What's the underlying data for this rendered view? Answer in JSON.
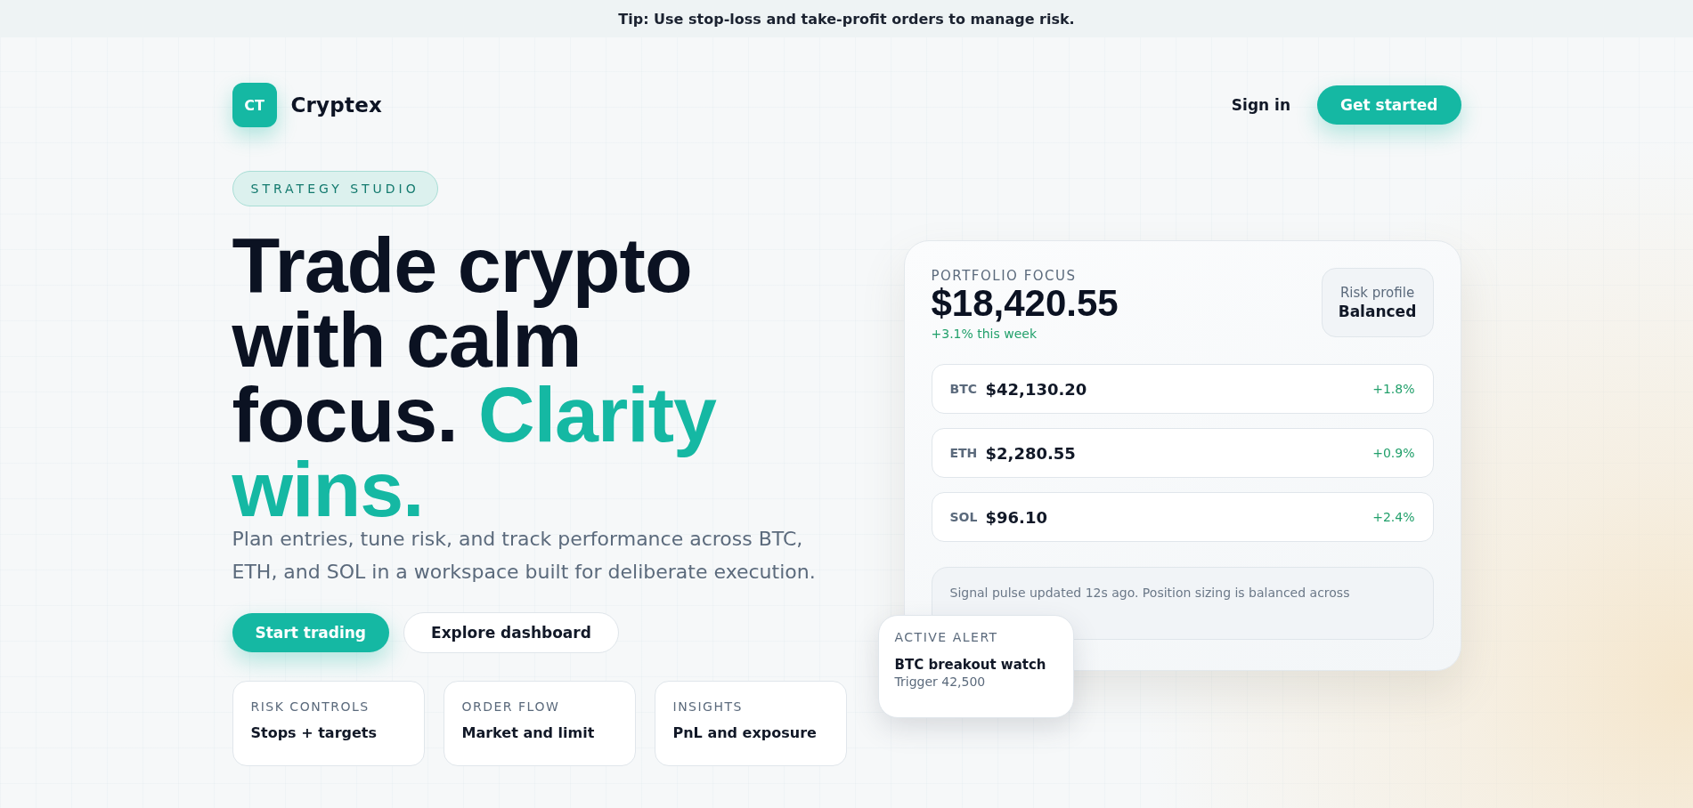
{
  "tip": "Tip: Use stop-loss and take-profit orders to manage risk.",
  "brand": {
    "mark": "CT",
    "name": "Cryptex"
  },
  "nav": {
    "sign_in": "Sign in",
    "cta": "Get started"
  },
  "hero": {
    "badge": "STRATEGY STUDIO",
    "headline": [
      [
        {
          "text": "Trade crypto",
          "accent": false
        }
      ],
      [
        {
          "text": "with calm",
          "accent": false
        }
      ],
      [
        {
          "text": "focus.",
          "accent": false
        },
        {
          "text": "Clarity",
          "accent": true
        }
      ],
      [
        {
          "text": "wins.",
          "accent": true
        }
      ]
    ],
    "lead": "Plan entries, tune risk, and track performance across BTC, ETH, and SOL in a workspace built for deliberate execution.",
    "buttons": [
      {
        "label": "Start trading",
        "kind": "primary"
      },
      {
        "label": "Explore dashboard",
        "kind": "secondary"
      }
    ],
    "features": [
      {
        "label": "RISK CONTROLS",
        "value": "Stops + targets"
      },
      {
        "label": "ORDER FLOW",
        "value": "Market and limit"
      },
      {
        "label": "INSIGHTS",
        "value": "PnL and exposure"
      }
    ]
  },
  "portfolio": {
    "label": "PORTFOLIO FOCUS",
    "value": "$18,420.55",
    "change": "+3.1% this week",
    "risk": {
      "label": "Risk profile",
      "value": "Balanced"
    },
    "assets": [
      {
        "symbol": "BTC",
        "price": "$42,130.20",
        "change": "+1.8%"
      },
      {
        "symbol": "ETH",
        "price": "$2,280.55",
        "change": "+0.9%"
      },
      {
        "symbol": "SOL",
        "price": "$96.10",
        "change": "+2.4%"
      }
    ],
    "note": "Signal pulse updated 12s ago. Position sizing is balanced across"
  },
  "alert": {
    "label": "ACTIVE ALERT",
    "title": "BTC breakout watch",
    "detail": "Trigger 42,500"
  }
}
